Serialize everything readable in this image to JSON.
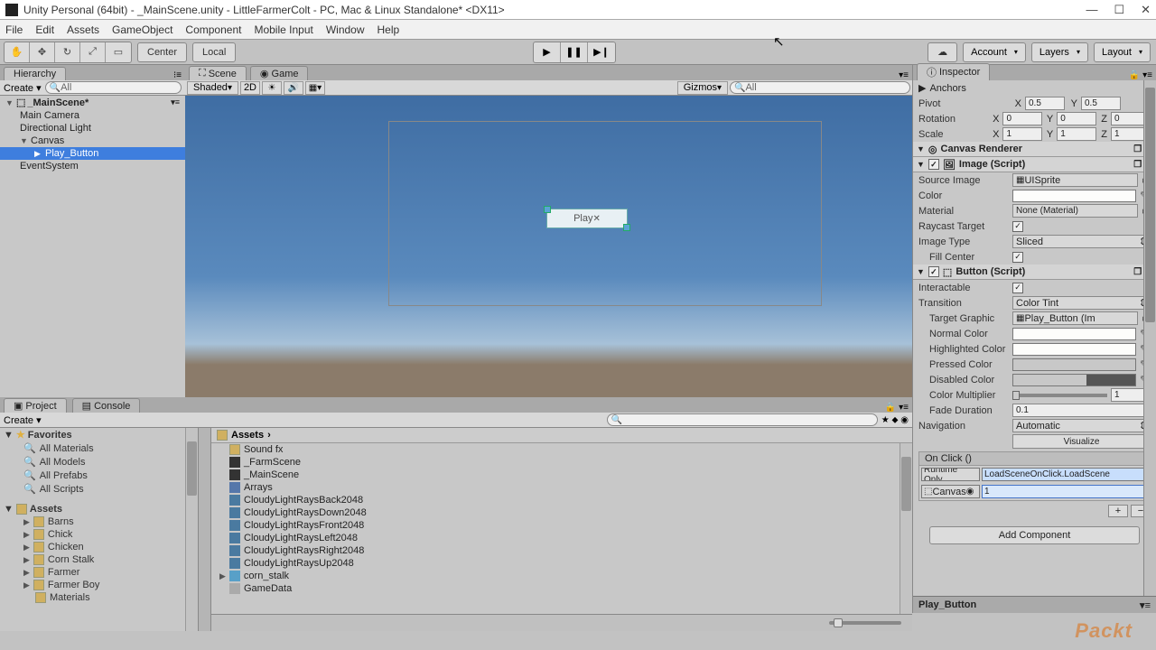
{
  "window": {
    "title": "Unity Personal (64bit) - _MainScene.unity - LittleFarmerColt - PC, Mac & Linux Standalone* <DX11>"
  },
  "menu": [
    "File",
    "Edit",
    "Assets",
    "GameObject",
    "Component",
    "Mobile Input",
    "Window",
    "Help"
  ],
  "toolbar": {
    "center": "Center",
    "local": "Local",
    "account": "Account",
    "layers": "Layers",
    "layout": "Layout"
  },
  "hierarchy": {
    "tab": "Hierarchy",
    "create": "Create",
    "search_ph": "All",
    "root": "_MainScene*",
    "items": [
      "Main Camera",
      "Directional Light",
      "Canvas",
      "Play_Button",
      "EventSystem"
    ]
  },
  "scene": {
    "tab_scene": "Scene",
    "tab_game": "Game",
    "shading": "Shaded",
    "mode2d": "2D",
    "gizmos": "Gizmos",
    "search_ph": "All",
    "button_text": "Play"
  },
  "project": {
    "tab_project": "Project",
    "tab_console": "Console",
    "create": "Create",
    "fav_head": "Favorites",
    "favs": [
      "All Materials",
      "All Models",
      "All Prefabs",
      "All Scripts"
    ],
    "assets_head": "Assets",
    "folders": [
      "Barns",
      "Chick",
      "Chicken",
      "Corn Stalk",
      "Farmer",
      "Farmer Boy",
      "Materials"
    ],
    "breadcrumb": "Assets",
    "list": [
      {
        "icon": "fold-c",
        "name": "Sound fx"
      },
      {
        "icon": "unity",
        "name": "_FarmScene"
      },
      {
        "icon": "unity",
        "name": "_MainScene"
      },
      {
        "icon": "cs",
        "name": "Arrays"
      },
      {
        "icon": "tex",
        "name": "CloudyLightRaysBack2048"
      },
      {
        "icon": "tex",
        "name": "CloudyLightRaysDown2048"
      },
      {
        "icon": "tex",
        "name": "CloudyLightRaysFront2048"
      },
      {
        "icon": "tex",
        "name": "CloudyLightRaysLeft2048"
      },
      {
        "icon": "tex",
        "name": "CloudyLightRaysRight2048"
      },
      {
        "icon": "tex",
        "name": "CloudyLightRaysUp2048"
      },
      {
        "icon": "pf",
        "name": "corn_stalk"
      },
      {
        "icon": "data",
        "name": "GameData"
      }
    ]
  },
  "inspector": {
    "tab": "Inspector",
    "anchors": "Anchors",
    "pivot_lbl": "Pivot",
    "pivot_x": "0.5",
    "pivot_y": "0.5",
    "rotation_lbl": "Rotation",
    "rx": "0",
    "ry": "0",
    "rz": "0",
    "scale_lbl": "Scale",
    "sx": "1",
    "sy": "1",
    "sz": "1",
    "canvas_renderer": "Canvas Renderer",
    "image_head": "Image (Script)",
    "source_image_lbl": "Source Image",
    "source_image": "UISprite",
    "color_lbl": "Color",
    "material_lbl": "Material",
    "material": "None (Material)",
    "raycast_lbl": "Raycast Target",
    "img_type_lbl": "Image Type",
    "img_type": "Sliced",
    "fill_center_lbl": "Fill Center",
    "button_head": "Button (Script)",
    "interactable_lbl": "Interactable",
    "transition_lbl": "Transition",
    "transition": "Color Tint",
    "target_lbl": "Target Graphic",
    "target": "Play_Button (Im",
    "normal_lbl": "Normal Color",
    "high_lbl": "Highlighted Color",
    "press_lbl": "Pressed Color",
    "disab_lbl": "Disabled Color",
    "mult_lbl": "Color Multiplier",
    "mult": "1",
    "fade_lbl": "Fade Duration",
    "fade": "0.1",
    "nav_lbl": "Navigation",
    "nav": "Automatic",
    "visualize": "Visualize",
    "onclick": "On Click ()",
    "runtime": "Runtime Only",
    "method": "LoadSceneOnClick.LoadScene",
    "obj": "Canvas",
    "arg": "1",
    "add": "Add Component",
    "footer": "Play_Button"
  },
  "watermark": "Packt"
}
